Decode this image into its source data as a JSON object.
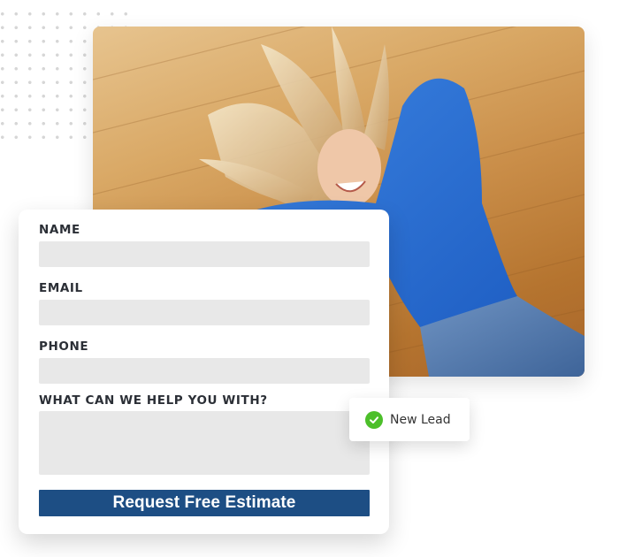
{
  "form": {
    "fields": [
      {
        "label": "NAME",
        "value": "",
        "placeholder": ""
      },
      {
        "label": "EMAIL",
        "value": "",
        "placeholder": ""
      },
      {
        "label": "PHONE",
        "value": "",
        "placeholder": ""
      },
      {
        "label": "WHAT CAN WE HELP YOU WITH?",
        "value": "",
        "placeholder": ""
      }
    ],
    "submit_label": "Request Free Estimate",
    "submit_color": "#1d4e84"
  },
  "notification": {
    "icon": "check-circle-icon",
    "text": "New Lead",
    "icon_color": "#4cbf2a"
  },
  "photo": {
    "description": "Smiling woman with blonde hair in a blue sweater lying on a wooden floor"
  }
}
